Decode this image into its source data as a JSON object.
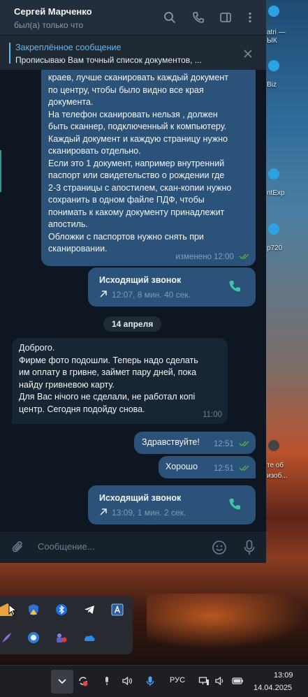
{
  "header": {
    "contact_name": "Сергей Марченко",
    "status": "был(а) только что"
  },
  "pinned": {
    "title": "Закреплённое сообщение",
    "text": "Прописываю Вам точный список документов, ..."
  },
  "messages": [
    {
      "type": "text",
      "direction": "out",
      "text": "краев, лучше сканировать каждый документ\nпо центру, чтобы было видно все края\nдокумента.\nНа телефон сканировать нельзя , должен\nбыть сканнер, подключенный к компьютеру.\nКаждый документ и каждую страницу нужно\nсканировать отдельно.\nЕсли это 1 документ, например внутренний\nпаспорт или свидетельство о рождении где\n2-3 страницы с апостилем,  скан-копии нужно\nсохранить в одном файле ПДФ, чтобы\nпонимать к какому документу принадлежит\nапостиль.\nОбложки с паспортов нужно снять при\nсканировании.",
      "meta": "изменено 12:00"
    },
    {
      "type": "call",
      "direction": "out",
      "title": "Исходящий звонок",
      "details": "12:07, 8 мин. 40 сек."
    },
    {
      "type": "date",
      "label": "14 апреля"
    },
    {
      "type": "text",
      "direction": "in",
      "text": "Доброго.\nФирме фото подошли. Теперь надо сделать\nим оплату в гривне, займет пару дней, пока\nнайду гривневою карту.\nДля Вас нічого не сделали, не работал копі\nцентр. Сегодня подойду снова.",
      "meta": "11:00"
    },
    {
      "type": "text",
      "direction": "out",
      "text": "Здравствуйте!",
      "meta": "12:51"
    },
    {
      "type": "text",
      "direction": "out",
      "text": "Хорошо",
      "meta": "12:51"
    },
    {
      "type": "call",
      "direction": "out",
      "title": "Исходящий звонок",
      "details": "13:09, 1 мин. 2 сек."
    }
  ],
  "composer": {
    "placeholder": "Сообщение..."
  },
  "desktop": {
    "labels": [
      "atri —",
      "ЫК",
      "Biz",
      "ntExp",
      "p720",
      "те об",
      "изоб..."
    ]
  },
  "taskbar": {
    "language": "РУС",
    "time": "13:09",
    "date": "14.04.2025"
  },
  "colors": {
    "accent": "#5eb5f7",
    "outgoing_bubble": "#2b5278",
    "incoming_bubble": "#182533",
    "chat_bg": "#0e1621",
    "check_read": "#4fae4e"
  }
}
